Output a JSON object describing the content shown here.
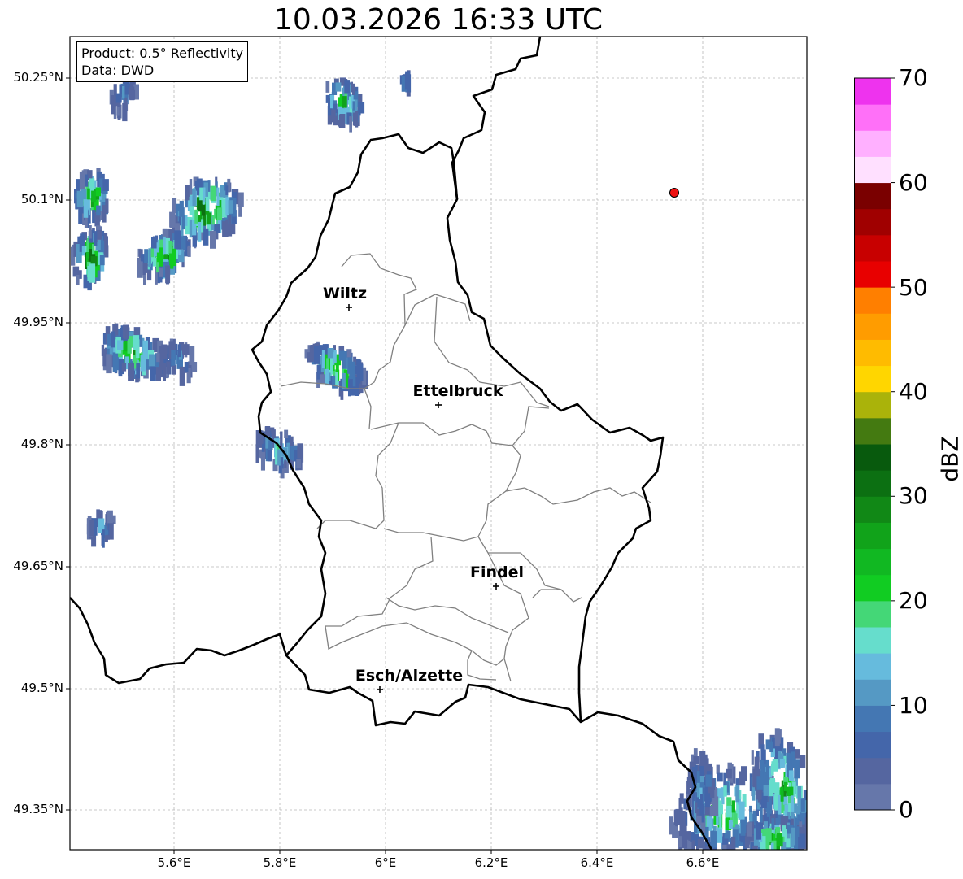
{
  "title": "10.03.2026 16:33 UTC",
  "info": {
    "product": "Product: 0.5° Reflectivity",
    "data": "Data: DWD"
  },
  "lat_ticks": [
    "50.25°N",
    "50.1°N",
    "49.95°N",
    "49.8°N",
    "49.65°N",
    "49.5°N",
    "49.35°N"
  ],
  "lon_ticks": [
    "5.6°E",
    "5.8°E",
    "6°E",
    "6.2°E",
    "6.4°E",
    "6.6°E"
  ],
  "cities": [
    {
      "name": "Wiltz"
    },
    {
      "name": "Ettelbruck"
    },
    {
      "name": "Findel"
    },
    {
      "name": "Esch/Alzette"
    }
  ],
  "colorbar": {
    "unit": "dBZ",
    "tick_labels": [
      "70",
      "60",
      "50",
      "40",
      "30",
      "20",
      "10",
      "0"
    ],
    "colors": [
      "#6677aa",
      "#5566a0",
      "#4466aa",
      "#4477b3",
      "#5599c4",
      "#66bbdd",
      "#66ddcc",
      "#44d777",
      "#11cc22",
      "#11b822",
      "#11a31a",
      "#118816",
      "#0c7012",
      "#085a0d",
      "#447a11",
      "#aab30a",
      "#ffd600",
      "#ffbb00",
      "#ff9c00",
      "#ff7f00",
      "#e80000",
      "#c80000",
      "#a00000",
      "#7a0000",
      "#ffe0ff",
      "#ffb0ff",
      "#ff70f8",
      "#ee33ee"
    ]
  },
  "marker_color": "#ee1111"
}
